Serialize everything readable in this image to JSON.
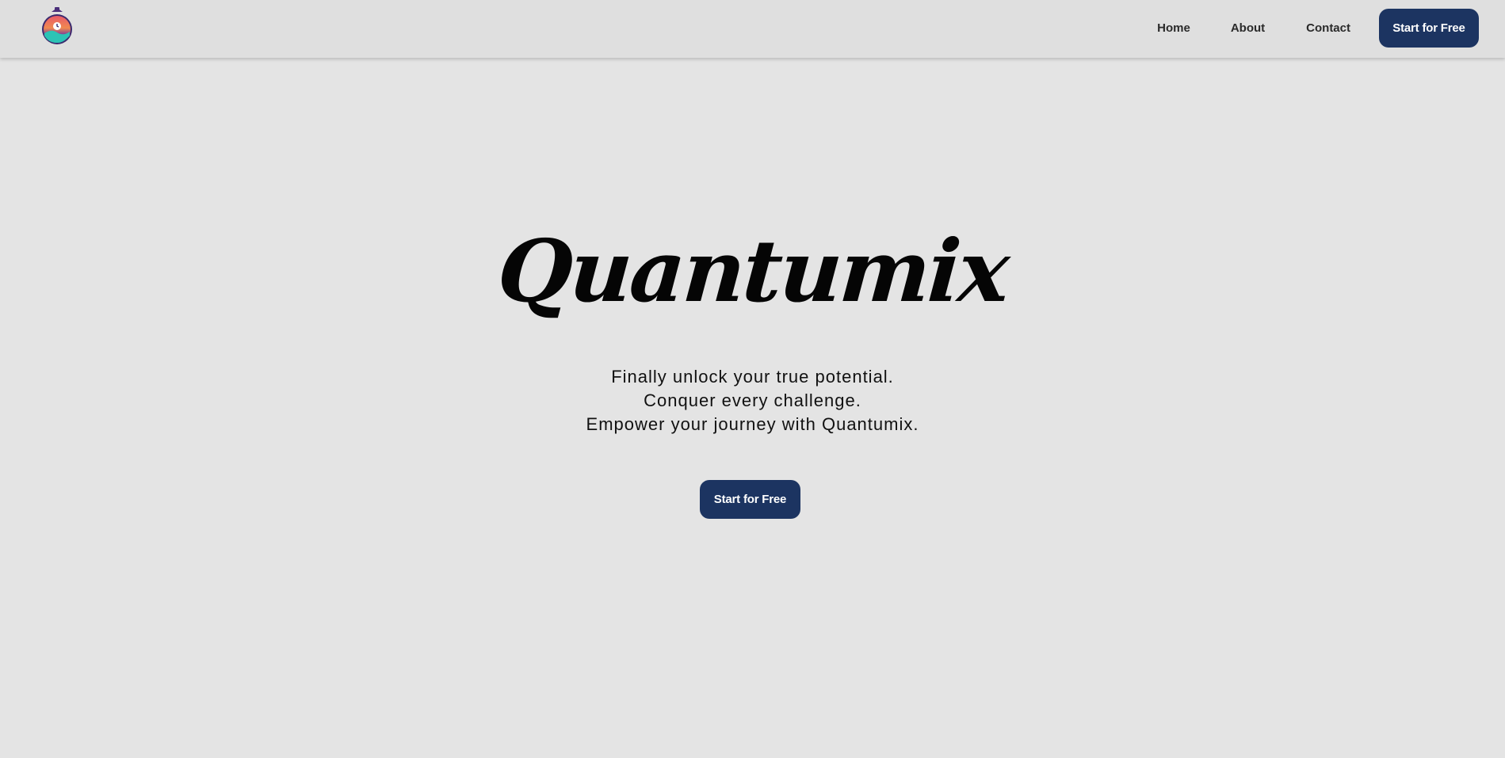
{
  "header": {
    "logo_icon": "stopwatch-logo-icon",
    "nav": {
      "home_label": "Home",
      "about_label": "About",
      "contact_label": "Contact",
      "cta_label": "Start for Free"
    }
  },
  "hero": {
    "title": "Quantumix",
    "tagline": [
      "Finally unlock your true potential.",
      "Conquer every challenge.",
      "Empower your journey with Quantumix."
    ],
    "cta_label": "Start for Free"
  },
  "colors": {
    "background": "#e4e4e4",
    "navbar": "#dfdfdf",
    "accent": "#1c3461",
    "text": "#050505"
  }
}
